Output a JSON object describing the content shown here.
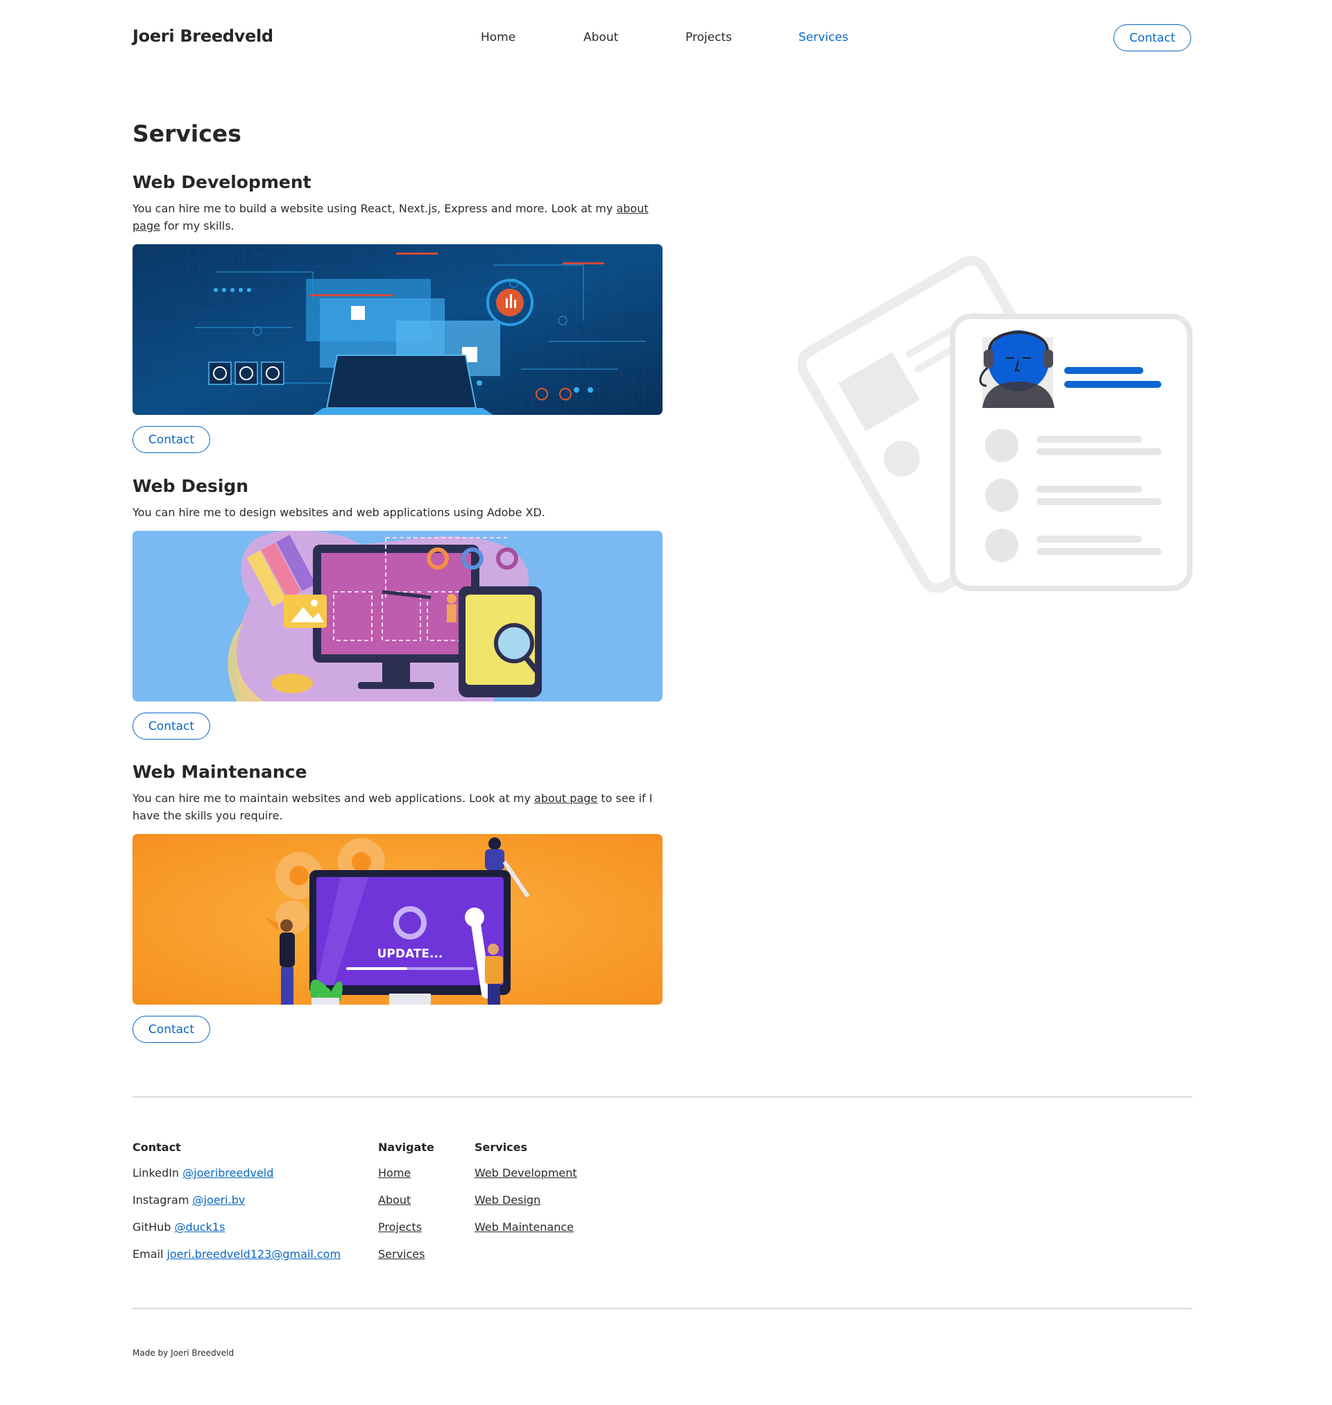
{
  "header": {
    "brand": "Joeri Breedveld",
    "nav": {
      "home": "Home",
      "about": "About",
      "projects": "Projects",
      "services": "Services"
    },
    "contact_button": "Contact",
    "accent_color": "#0b66c3"
  },
  "main": {
    "title": "Services",
    "services": [
      {
        "title": "Web Development",
        "desc_before": "You can hire me to build a website using React, Next.js, Express and more. Look at my ",
        "link": "about page",
        "desc_after": " for my skills.",
        "button": "Contact"
      },
      {
        "title": "Web Design",
        "desc_before": "You can hire me to design websites and web applications using Adobe XD.",
        "button": "Contact"
      },
      {
        "title": "Web Maintenance",
        "desc_before": "You can hire me to maintain websites and web applications. Look at my ",
        "link": "about page",
        "desc_after": " to see if I have the skills you require.",
        "button": "Contact",
        "image_text": "UPDATE..."
      }
    ]
  },
  "footer": {
    "contact": {
      "heading": "Contact",
      "linkedin_label": "LinkedIn",
      "linkedin_handle": "@joeribreedveld",
      "instagram_label": "Instagram",
      "instagram_handle": "@joeri.bv",
      "github_label": "GitHub",
      "github_handle": "@duck1s",
      "email_label": "Email",
      "email_value": "joeri.breedveld123@gmail.com"
    },
    "navigate": {
      "heading": "Navigate",
      "items": [
        "Home",
        "About",
        "Projects",
        "Services"
      ]
    },
    "services": {
      "heading": "Services",
      "items": [
        "Web Development",
        "Web Design",
        "Web Maintenance"
      ]
    },
    "made_by": "Made by Joeri Breedveld"
  }
}
